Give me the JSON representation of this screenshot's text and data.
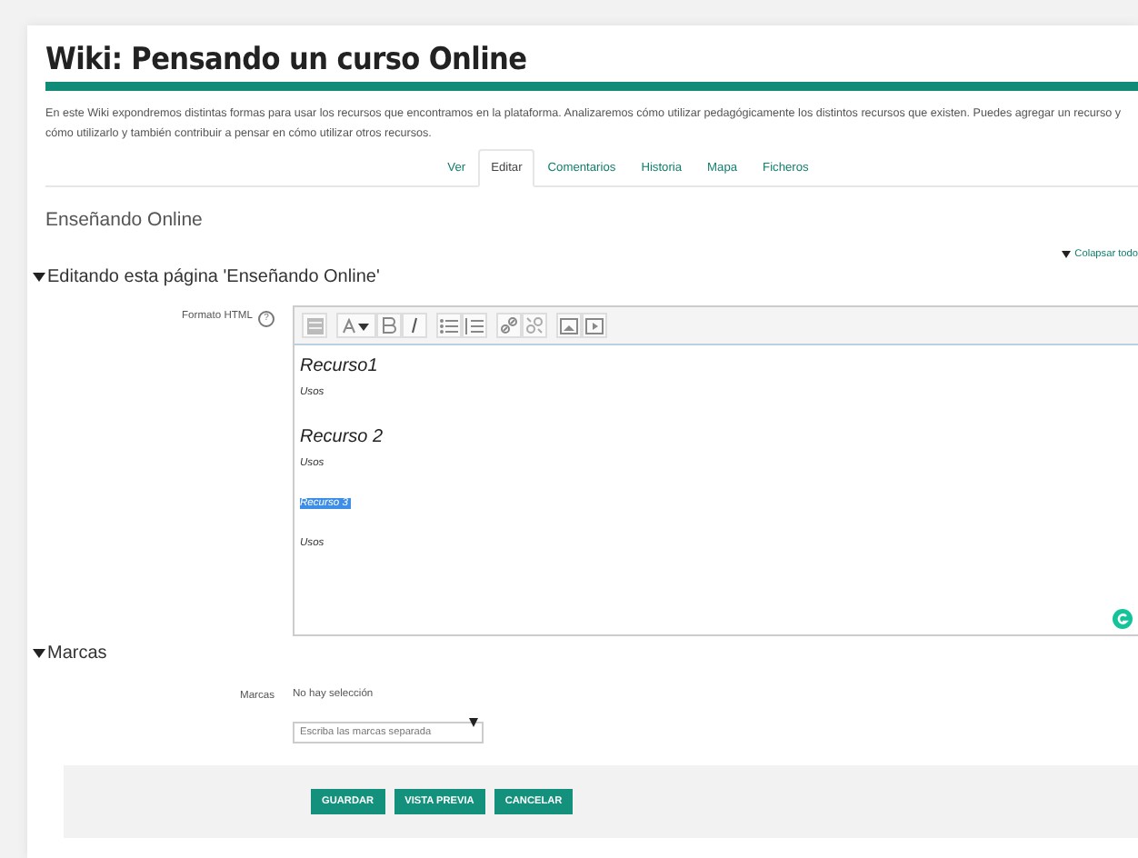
{
  "page_title": "Wiki: Pensando un curso Online",
  "description": "En este Wiki expondremos distintas formas para usar los recursos que encontramos en la plataforma. Analizaremos cómo utilizar pedagógicamente los distintos recursos que existen. Puedes agregar un recurso y cómo utilizarlo y también contribuir a pensar en cómo utilizar otros recursos.",
  "tabs": [
    {
      "label": "Ver",
      "selected": false
    },
    {
      "label": "Editar",
      "selected": true
    },
    {
      "label": "Comentarios",
      "selected": false
    },
    {
      "label": "Historia",
      "selected": false
    },
    {
      "label": "Mapa",
      "selected": false
    },
    {
      "label": "Ficheros",
      "selected": false
    }
  ],
  "wiki_page_title": "Enseñando Online",
  "collapse_all": "Colapsar todo",
  "edit_section": {
    "title": "Editando esta página 'Enseñando Online'",
    "expanded": true,
    "format_label": "Formato HTML",
    "help_glyph": "?",
    "content": [
      {
        "kind": "heading",
        "text": "Recurso1",
        "selected": false
      },
      {
        "kind": "body",
        "text": "Usos",
        "selected": false
      },
      {
        "kind": "heading",
        "text": "Recurso 2",
        "selected": false
      },
      {
        "kind": "body",
        "text": "Usos",
        "selected": false
      },
      {
        "kind": "body",
        "text": "Recurso 3",
        "selected": true
      },
      {
        "kind": "body",
        "text": "Usos",
        "selected": false
      }
    ]
  },
  "tags_section": {
    "title": "Marcas",
    "expanded": true,
    "label": "Marcas",
    "selection": "No hay selección",
    "placeholder": "Escriba las marcas separada"
  },
  "buttons": [
    "GUARDAR",
    "VISTA PREVIA",
    "CANCELAR"
  ]
}
